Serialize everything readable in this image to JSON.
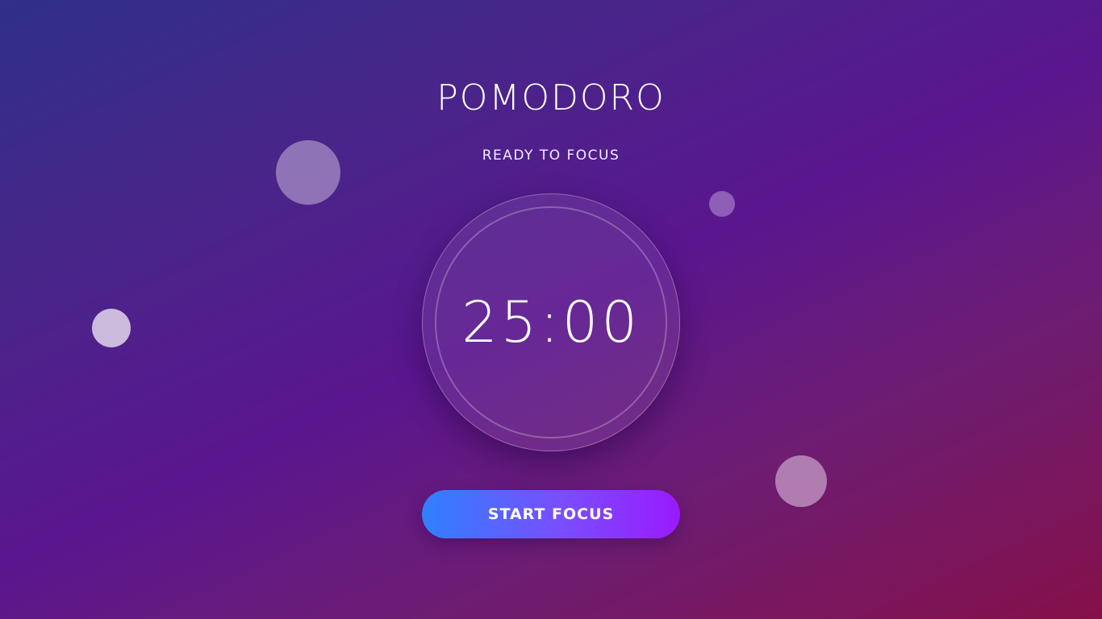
{
  "app": {
    "title": "POMODORO",
    "status": "READY TO FOCUS"
  },
  "timer": {
    "display": "25:00"
  },
  "controls": {
    "start_label": "START FOCUS"
  },
  "colors": {
    "button_gradient_start": "#2f80ff",
    "button_gradient_end": "#9a1aff",
    "background_top": "#2f2f8a",
    "background_bottom": "#85104a"
  }
}
